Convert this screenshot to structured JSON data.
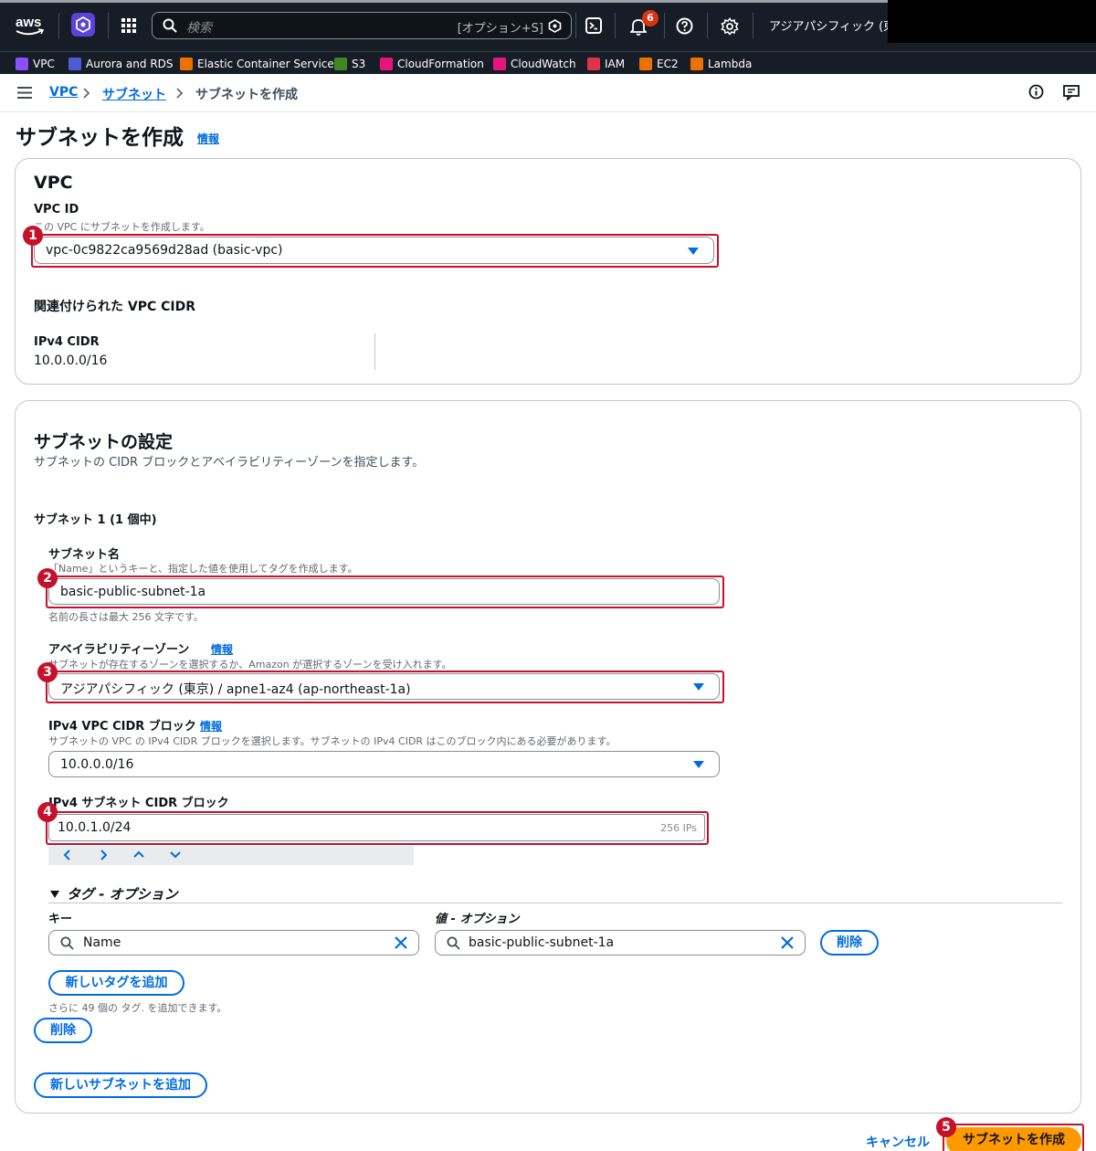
{
  "topnav": {
    "search_placeholder": "検索",
    "search_shortcut": "[オプション+S]",
    "notification_count": "6",
    "region": "アジアパシフィック (東京"
  },
  "favorites": [
    "VPC",
    "Aurora and RDS",
    "Elastic Container Service",
    "S3",
    "CloudFormation",
    "CloudWatch",
    "IAM",
    "EC2",
    "Lambda"
  ],
  "breadcrumb": {
    "vpc": "VPC",
    "subnets": "サブネット",
    "current": "サブネットを作成"
  },
  "page": {
    "title": "サブネットを作成",
    "info": "情報"
  },
  "vpc_section": {
    "heading": "VPC",
    "vpc_id_label": "VPC ID",
    "vpc_id_desc": "この VPC にサブネットを作成します。",
    "vpc_id_value": "vpc-0c9822ca9569d28ad (basic-vpc)",
    "cidr_heading": "関連付けられた VPC CIDR",
    "ipv4_label": "IPv4 CIDR",
    "ipv4_value": "10.0.0.0/16"
  },
  "subnet_settings": {
    "heading": "サブネットの設定",
    "desc": "サブネットの CIDR ブロックとアベイラビリティーゾーンを指定します。",
    "subnet_count": "サブネット 1 (1 個中)",
    "name_label": "サブネット名",
    "name_desc": "「Name」というキーと、指定した値を使用してタグを作成します。",
    "name_value": "basic-public-subnet-1a",
    "name_hint": "名前の長さは最大 256 文字です。",
    "az_label": "アベイラビリティーゾーン",
    "az_info": "情報",
    "az_desc": "サブネットが存在するゾーンを選択するか、Amazon が選択するゾーンを受け入れます。",
    "az_value": "アジアパシフィック (東京) / apne1-az4 (ap-northeast-1a)",
    "vpc_cidr_label": "IPv4 VPC CIDR ブロック",
    "vpc_cidr_info": "情報",
    "vpc_cidr_desc": "サブネットの VPC の IPv4 CIDR ブロックを選択します。サブネットの IPv4 CIDR はこのブロック内にある必要があります。",
    "vpc_cidr_value": "10.0.0.0/16",
    "subnet_cidr_label": "IPv4 サブネット CIDR ブロック",
    "subnet_cidr_value": "10.0.1.0/24",
    "subnet_cidr_ips": "256 IPs",
    "tags_heading": "タグ - オプション",
    "key_label": "キー",
    "value_label": "値 - オプション",
    "tag_key": "Name",
    "tag_value": "basic-public-subnet-1a",
    "remove_tag": "削除",
    "add_tag": "新しいタグを追加",
    "tags_remaining": "さらに 49 個の タグ. を追加できます。",
    "remove_subnet": "削除",
    "add_subnet": "新しいサブネットを追加"
  },
  "footer": {
    "cancel": "キャンセル",
    "create": "サブネットを作成"
  },
  "markers": [
    "1",
    "2",
    "3",
    "4",
    "5"
  ],
  "colors": {
    "nav_bg": "#161d26",
    "link": "#006ce0",
    "primary_button": "#ff9900",
    "highlight": "#c7102a"
  }
}
